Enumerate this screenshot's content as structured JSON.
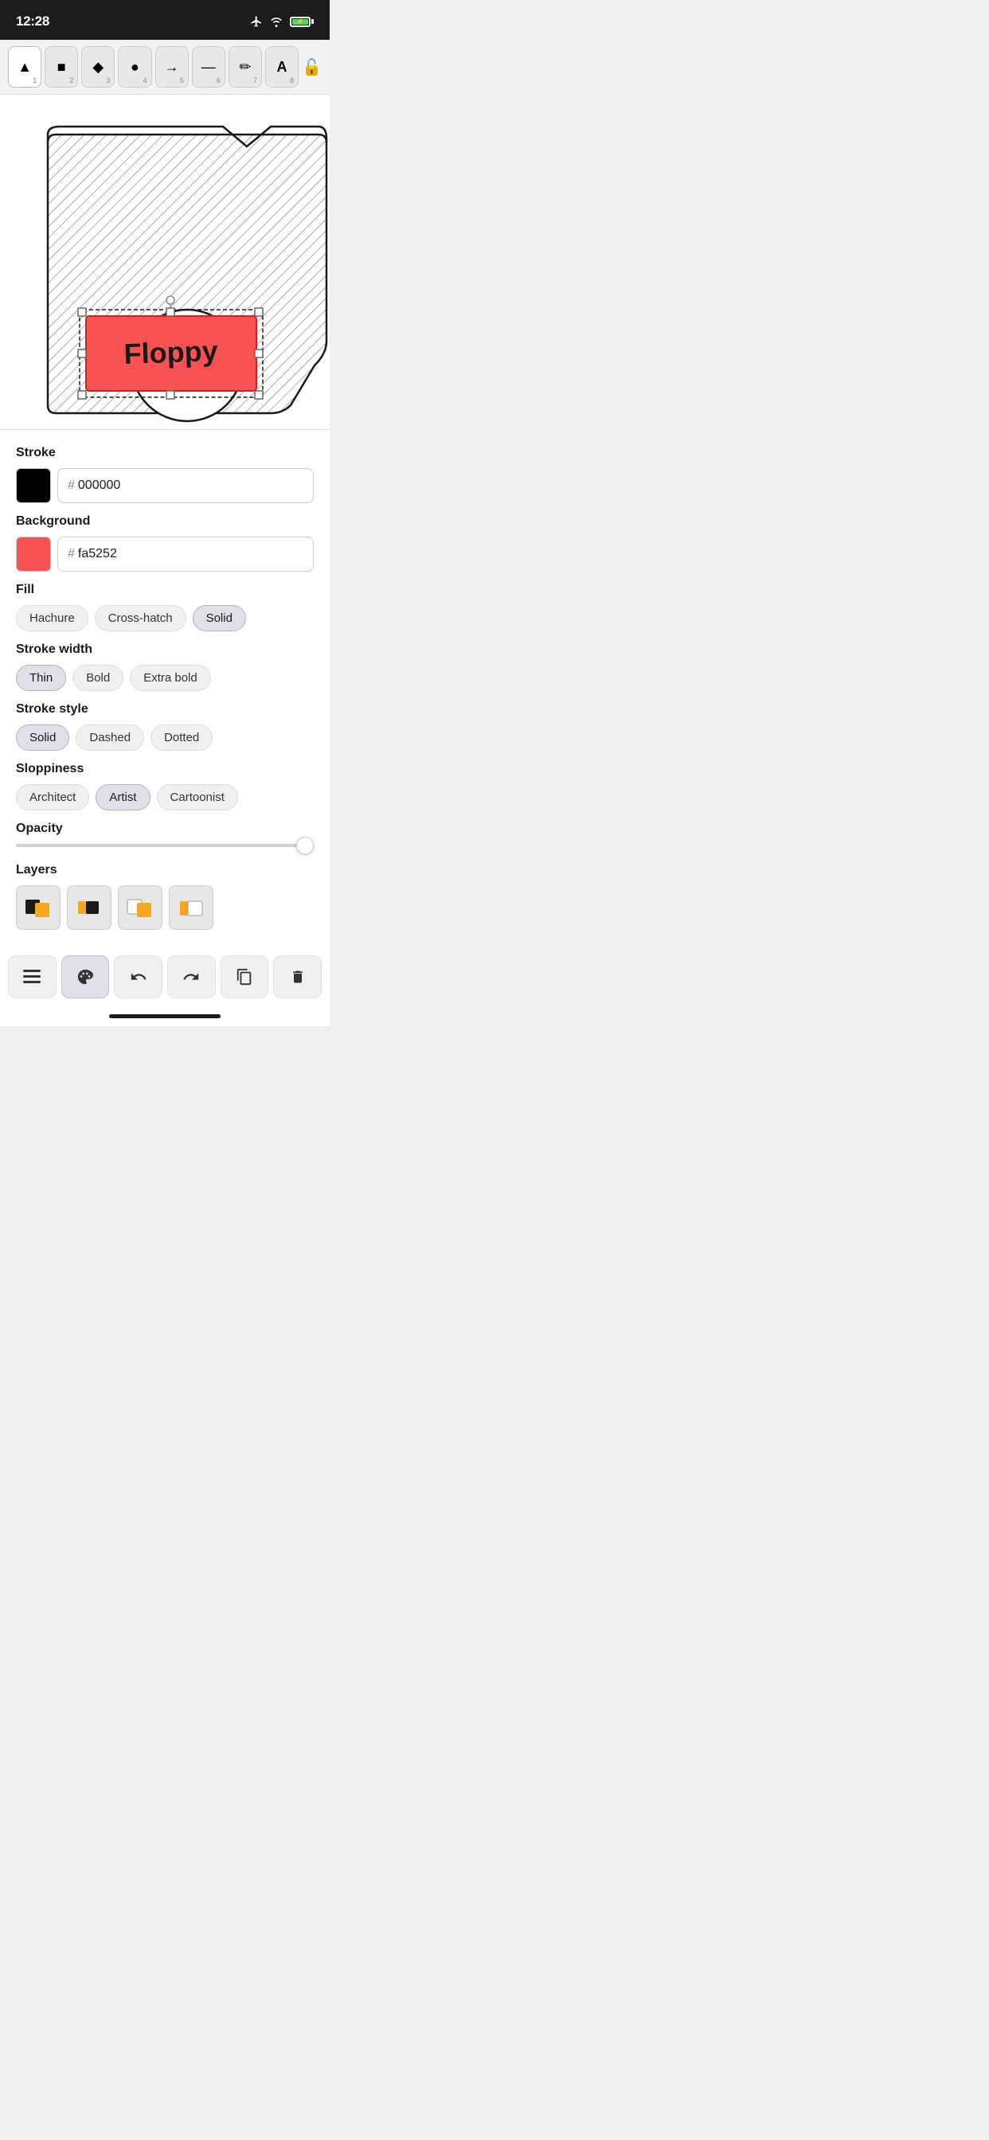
{
  "statusBar": {
    "time": "12:28",
    "icons": {
      "location": "location-icon",
      "airplane": "airplane-icon",
      "wifi": "wifi-icon",
      "battery": "battery-icon"
    }
  },
  "toolbar": {
    "tools": [
      {
        "id": "select",
        "label": "▲",
        "number": "1",
        "active": false,
        "unicode": "▲"
      },
      {
        "id": "rectangle",
        "label": "■",
        "number": "2",
        "active": false,
        "unicode": "■"
      },
      {
        "id": "diamond",
        "label": "◆",
        "number": "3",
        "active": false,
        "unicode": "◆"
      },
      {
        "id": "ellipse",
        "label": "●",
        "number": "4",
        "active": false,
        "unicode": "●"
      },
      {
        "id": "arrow",
        "label": "→",
        "number": "5",
        "active": false,
        "unicode": "→"
      },
      {
        "id": "line",
        "label": "—",
        "number": "6",
        "active": false,
        "unicode": "—"
      },
      {
        "id": "pencil",
        "label": "✏",
        "number": "7",
        "active": false,
        "unicode": "✏"
      },
      {
        "id": "text",
        "label": "A",
        "number": "8",
        "active": false,
        "unicode": "A"
      }
    ],
    "lock": "🔓"
  },
  "canvas": {
    "drawing": "floppy-disk-sketch"
  },
  "properties": {
    "stroke": {
      "label": "Stroke",
      "color": "#000000",
      "hex": "000000"
    },
    "background": {
      "label": "Background",
      "color": "#fa5252",
      "hex": "fa5252"
    },
    "fill": {
      "label": "Fill",
      "options": [
        "Hachure",
        "Cross-hatch",
        "Solid"
      ],
      "active": "Solid"
    },
    "strokeWidth": {
      "label": "Stroke width",
      "options": [
        "Thin",
        "Bold",
        "Extra bold"
      ],
      "active": "Thin"
    },
    "strokeStyle": {
      "label": "Stroke style",
      "options": [
        "Solid",
        "Dashed",
        "Dotted"
      ],
      "active": "Solid"
    },
    "sloppiness": {
      "label": "Sloppiness",
      "options": [
        "Architect",
        "Artist",
        "Cartoonist"
      ],
      "active": "Artist"
    },
    "opacity": {
      "label": "Opacity",
      "value": 100
    },
    "layers": {
      "label": "Layers",
      "items": [
        {
          "id": "layer1",
          "icon": "⬛🟧"
        },
        {
          "id": "layer2",
          "icon": "🟧⬛"
        },
        {
          "id": "layer3",
          "icon": "⬜🟧"
        },
        {
          "id": "layer4",
          "icon": "🟧⬜"
        }
      ]
    }
  },
  "actionBar": {
    "buttons": [
      {
        "id": "menu",
        "icon": "☰",
        "label": "menu"
      },
      {
        "id": "style",
        "icon": "🎨",
        "label": "style",
        "active": true
      },
      {
        "id": "undo",
        "icon": "↩",
        "label": "undo"
      },
      {
        "id": "redo",
        "icon": "↪",
        "label": "redo"
      },
      {
        "id": "copy",
        "icon": "⧉",
        "label": "copy"
      },
      {
        "id": "delete",
        "icon": "🗑",
        "label": "delete"
      }
    ]
  }
}
